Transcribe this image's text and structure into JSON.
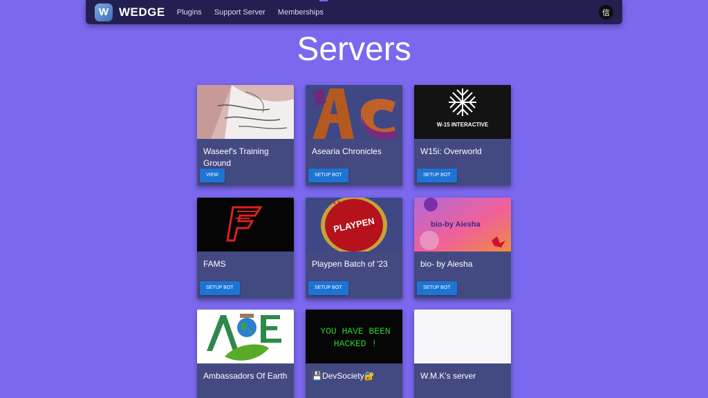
{
  "nav": {
    "logo_letter": "W",
    "brand": "WEDGE",
    "links": [
      "Plugins",
      "Support Server",
      "Memberships"
    ],
    "avatar_glyph": "信"
  },
  "page": {
    "title": "Servers"
  },
  "servers": [
    {
      "name": "Waseef's Training Ground",
      "button": "VIEW"
    },
    {
      "name": "Asearia Chronicles",
      "button": "SETUP BOT"
    },
    {
      "name": "W15i: Overworld",
      "button": "SETUP BOT",
      "image_text": "W-15 INTERACTIVE"
    },
    {
      "name": "FAMS",
      "button": "SETUP BOT"
    },
    {
      "name": "Playpen Batch of '23",
      "button": "SETUP BOT",
      "image_text": "PLAYPEN"
    },
    {
      "name": "bio- by Aiesha",
      "button": "SETUP BOT",
      "image_text": "bio-by Aiesha"
    },
    {
      "name": "Ambassadors Of Earth",
      "image_text": "AOE"
    },
    {
      "name": "💾DevSociety🔐",
      "image_text": [
        "YOU HAVE BEEN",
        "HACKED !"
      ]
    },
    {
      "name": "W.M.K's server"
    }
  ],
  "colors": {
    "background": "#7b68ee",
    "navbar": "#232051",
    "card": "#434a82",
    "button": "#1e74d4"
  }
}
